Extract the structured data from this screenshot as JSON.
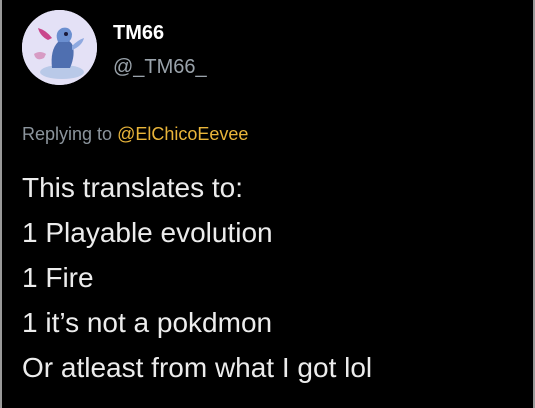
{
  "tweet": {
    "display_name": "TM66",
    "handle": "@_TM66_",
    "replying_prefix": "Replying to",
    "replying_to": "@ElChicoEevee",
    "lines": [
      "This translates to:",
      "1 Playable evolution",
      "1 Fire",
      "1 it’s not a pokdmon",
      "Or atleast from what I got lol"
    ]
  },
  "colors": {
    "background": "#000000",
    "mention": "#e9b53a",
    "handle": "#9aa3ab"
  }
}
